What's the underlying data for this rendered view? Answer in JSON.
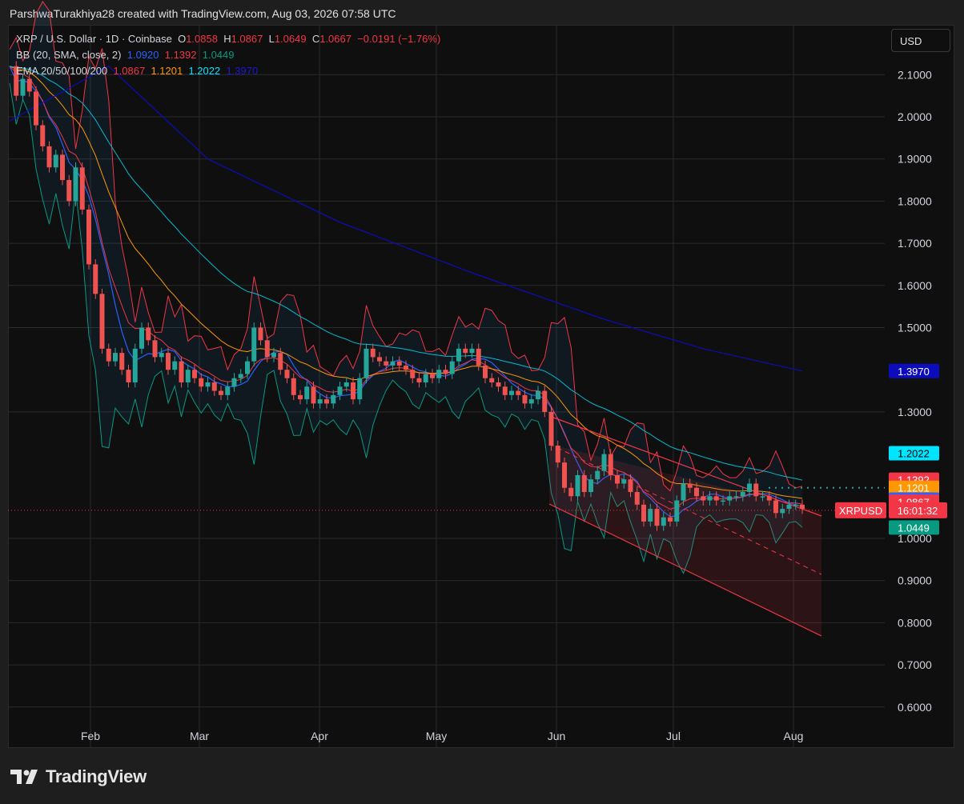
{
  "header": {
    "caption": "ParshwaTurakhiya28 created with TradingView.com, Aug 03, 2026 07:58 UTC"
  },
  "legend": {
    "symbol": "XRP / U.S. Dollar · 1D · Coinbase",
    "o_label": "O",
    "o_value": "1.0858",
    "h_label": "H",
    "h_value": "1.0867",
    "l_label": "L",
    "l_value": "1.0649",
    "c_label": "C",
    "c_value": "1.0667",
    "change": "−0.0191 (−1.76%)",
    "bb_label": "BB (20, SMA, close, 2)",
    "bb_values": [
      "1.0920",
      "1.1392",
      "1.0449"
    ],
    "ema_label": "EMA 20/50/100/200",
    "ema_values": [
      "1.0867",
      "1.1201",
      "1.2022",
      "1.3970"
    ]
  },
  "currency_button": "USD",
  "footer": {
    "brand": "TradingView"
  },
  "colors": {
    "up": "#26a69a",
    "down": "#ef5350",
    "bb_basis": "#2962ff",
    "bb_upper": "#f23645",
    "bb_lower": "#089981",
    "ema20": "#f23645",
    "ema50": "#ff9800",
    "ema100": "#00bcd4",
    "ema200": "#0c0cbc"
  },
  "chart_data": {
    "type": "candlestick",
    "title": "XRP / U.S. Dollar · 1D · Coinbase",
    "ylim": [
      0.56,
      2.2
    ],
    "y_ticks": [
      "0.6000",
      "0.7000",
      "0.8000",
      "0.9000",
      "1.0000",
      "1.3000",
      "1.5000",
      "1.6000",
      "1.7000",
      "1.8000",
      "1.9000",
      "2.0000",
      "2.1000"
    ],
    "x_ticks": [
      "Feb",
      "Mar",
      "Apr",
      "May",
      "Jun",
      "Jul",
      "Aug"
    ],
    "last_close": 1.0667,
    "countdown": "16:01:32",
    "symbol_tag": "XRPUSD",
    "price_tags": [
      {
        "label": "1.3970",
        "value": 1.397,
        "color": "#0c0cbc"
      },
      {
        "label": "1.2022",
        "value": 1.2022,
        "color": "#00e5ff"
      },
      {
        "label": "1.1392",
        "value": 1.1392,
        "color": "#f23645"
      },
      {
        "label": "1.1201",
        "value": 1.1201,
        "color": "#ff9800"
      },
      {
        "label": "1.0920",
        "value": 1.092,
        "color": "#2962ff"
      },
      {
        "label": "1.0867",
        "value": 1.0867,
        "color": "#f23645"
      },
      {
        "label": "1.0449",
        "value": 1.0449,
        "color": "#089981"
      }
    ],
    "price_series": [
      [
        0,
        2.12
      ],
      [
        2,
        2.05
      ],
      [
        4,
        2.09
      ],
      [
        6,
        2.06
      ],
      [
        8,
        1.98
      ],
      [
        10,
        1.93
      ],
      [
        12,
        1.88
      ],
      [
        14,
        1.91
      ],
      [
        16,
        1.85
      ],
      [
        18,
        1.8
      ],
      [
        20,
        1.88
      ],
      [
        22,
        1.78
      ],
      [
        24,
        1.65
      ],
      [
        26,
        1.58
      ],
      [
        28,
        1.45
      ],
      [
        30,
        1.42
      ],
      [
        32,
        1.44
      ],
      [
        34,
        1.4
      ],
      [
        36,
        1.37
      ],
      [
        38,
        1.45
      ],
      [
        40,
        1.5
      ],
      [
        42,
        1.47
      ],
      [
        44,
        1.43
      ],
      [
        46,
        1.44
      ],
      [
        48,
        1.4
      ],
      [
        50,
        1.42
      ],
      [
        52,
        1.37
      ],
      [
        54,
        1.4
      ],
      [
        56,
        1.38
      ],
      [
        58,
        1.36
      ],
      [
        60,
        1.37
      ],
      [
        62,
        1.35
      ],
      [
        64,
        1.34
      ],
      [
        66,
        1.36
      ],
      [
        68,
        1.38
      ],
      [
        70,
        1.39
      ],
      [
        72,
        1.42
      ],
      [
        74,
        1.5
      ],
      [
        76,
        1.47
      ],
      [
        78,
        1.43
      ],
      [
        80,
        1.44
      ],
      [
        82,
        1.4
      ],
      [
        84,
        1.38
      ],
      [
        86,
        1.34
      ],
      [
        88,
        1.33
      ],
      [
        90,
        1.36
      ],
      [
        92,
        1.32
      ],
      [
        94,
        1.33
      ],
      [
        96,
        1.32
      ],
      [
        98,
        1.34
      ],
      [
        100,
        1.36
      ],
      [
        102,
        1.37
      ],
      [
        104,
        1.33
      ],
      [
        106,
        1.38
      ],
      [
        108,
        1.45
      ],
      [
        110,
        1.43
      ],
      [
        112,
        1.42
      ],
      [
        114,
        1.41
      ],
      [
        116,
        1.42
      ],
      [
        118,
        1.41
      ],
      [
        120,
        1.4
      ],
      [
        122,
        1.38
      ],
      [
        124,
        1.37
      ],
      [
        126,
        1.39
      ],
      [
        128,
        1.38
      ],
      [
        130,
        1.4
      ],
      [
        132,
        1.39
      ],
      [
        134,
        1.42
      ],
      [
        136,
        1.45
      ],
      [
        138,
        1.44
      ],
      [
        140,
        1.45
      ],
      [
        142,
        1.41
      ],
      [
        144,
        1.38
      ],
      [
        146,
        1.37
      ],
      [
        148,
        1.36
      ],
      [
        150,
        1.34
      ],
      [
        152,
        1.35
      ],
      [
        154,
        1.34
      ],
      [
        156,
        1.32
      ],
      [
        158,
        1.33
      ],
      [
        160,
        1.35
      ],
      [
        162,
        1.3
      ],
      [
        164,
        1.22
      ],
      [
        166,
        1.18
      ],
      [
        168,
        1.12
      ],
      [
        170,
        1.1
      ],
      [
        172,
        1.15
      ],
      [
        174,
        1.11
      ],
      [
        176,
        1.14
      ],
      [
        178,
        1.16
      ],
      [
        180,
        1.2
      ],
      [
        182,
        1.15
      ],
      [
        184,
        1.13
      ],
      [
        186,
        1.14
      ],
      [
        188,
        1.11
      ],
      [
        190,
        1.08
      ],
      [
        192,
        1.04
      ],
      [
        194,
        1.07
      ],
      [
        196,
        1.03
      ],
      [
        198,
        1.05
      ],
      [
        200,
        1.04
      ],
      [
        202,
        1.09
      ],
      [
        204,
        1.13
      ],
      [
        206,
        1.12
      ],
      [
        208,
        1.1
      ],
      [
        210,
        1.09
      ],
      [
        212,
        1.1
      ],
      [
        214,
        1.09
      ],
      [
        216,
        1.09
      ],
      [
        218,
        1.1
      ],
      [
        220,
        1.1
      ],
      [
        222,
        1.11
      ],
      [
        224,
        1.13
      ],
      [
        226,
        1.1
      ],
      [
        228,
        1.1
      ],
      [
        230,
        1.09
      ],
      [
        232,
        1.06
      ],
      [
        234,
        1.07
      ],
      [
        236,
        1.08
      ],
      [
        238,
        1.08
      ],
      [
        240,
        1.07
      ]
    ]
  }
}
